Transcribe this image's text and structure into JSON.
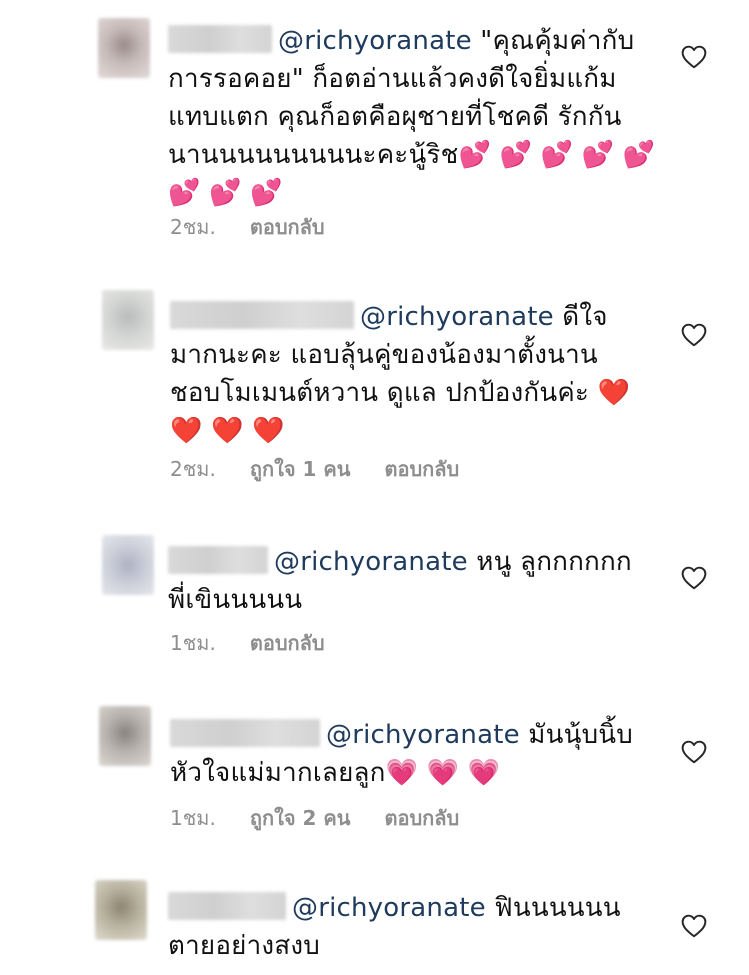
{
  "comments": [
    {
      "mention": "@richyoranate",
      "line1": "\"คุณคุ้มค่ากับ",
      "line2": "การรอคอย\" ก็อตอ่านแล้วคงดีใจยิ่มแก้ม",
      "line3": "แทบแตก คุณก็อตคือผุชายที่โชคดี รักกัน",
      "line4": "นานนนนนนนนนะคะนู้ริช",
      "emoji_row": "💕 💕 💕 💕 💕",
      "emoji_row2": "💕 💕 💕",
      "time": "2ชม.",
      "likes": "",
      "reply": "ตอบกลับ",
      "like_icon": "heart-outline-icon"
    },
    {
      "mention": "@richyoranate",
      "line1": "ดีใจ",
      "line2": "มากนะคะ แอบลุ้นคู่ของน้องมาตั้งนาน",
      "line3": "ชอบโมเมนต์หวาน ดูแล ปกป้องกันค่ะ",
      "emoji_inline": "❤️",
      "emoji_row": "❤️ ❤️ ❤️",
      "time": "2ชม.",
      "likes": "ถูกใจ 1 คน",
      "reply": "ตอบกลับ",
      "like_icon": "heart-outline-icon"
    },
    {
      "mention": "@richyoranate",
      "line1": "หนู ลูกกกกกก",
      "line2": "พี่เขินนนนน",
      "time": "1ชม.",
      "likes": "",
      "reply": "ตอบกลับ",
      "like_icon": "heart-outline-icon"
    },
    {
      "mention": "@richyoranate",
      "line1": "มันนุ้บนิ้บ",
      "line2": "หัวใจแม่มากเลยลูก",
      "emoji_row": "💗 💗 💗",
      "time": "1ชม.",
      "likes": "ถูกใจ 2 คน",
      "reply": "ตอบกลับ",
      "like_icon": "heart-outline-icon"
    },
    {
      "mention": "@richyoranate",
      "line1": "ฟินนนนนน",
      "line2": "ตายอย่างสงบ",
      "like_icon": "heart-outline-icon"
    }
  ],
  "colors": {
    "mention": "#1e3a5c",
    "meta": "#8e8e8e",
    "icon": "#262626"
  }
}
